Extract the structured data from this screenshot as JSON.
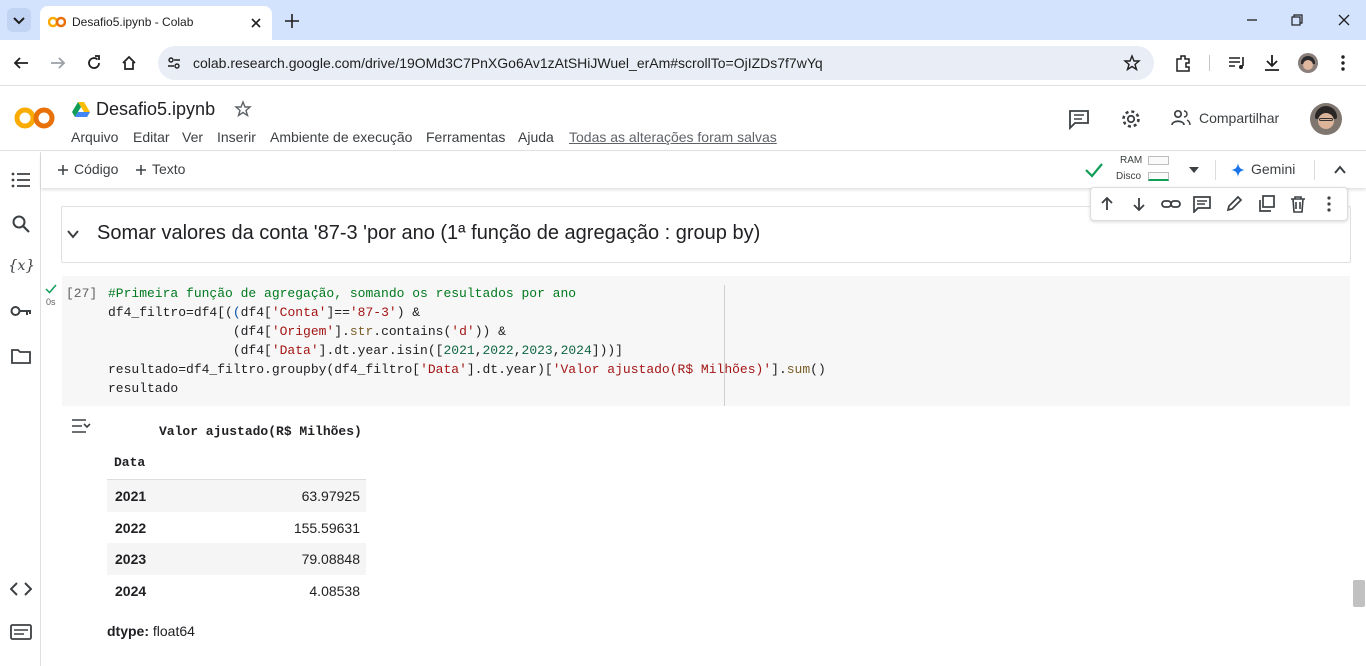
{
  "browser": {
    "tab_title": "Desafio5.ipynb - Colab",
    "url": "colab.research.google.com/drive/19OMd3C7PnXGo6Av1zAtSHiJWuel_erAm#scrollTo=OjIZDs7f7wYq"
  },
  "colab": {
    "notebook_title": "Desafio5.ipynb",
    "menu": [
      "Arquivo",
      "Editar",
      "Ver",
      "Inserir",
      "Ambiente de execução",
      "Ferramentas",
      "Ajuda"
    ],
    "save_status": "Todas as alterações foram salvas",
    "share_label": "Compartilhar",
    "toolbar": {
      "add_code": "Código",
      "add_text": "Texto",
      "ram_label": "RAM",
      "disk_label": "Disco",
      "gemini_label": "Gemini"
    }
  },
  "text_cell": {
    "heading": "Somar valores da conta '87-3 'por ano (1ª função de agregação : group by)"
  },
  "code_cell": {
    "exec_count": "[27]",
    "exec_time": "0s"
  },
  "output": {
    "series_name": "Valor ajustado(R$ Milhões)",
    "index_name": "Data",
    "rows": [
      {
        "year": "2021",
        "value": "63.97925"
      },
      {
        "year": "2022",
        "value": "155.59631"
      },
      {
        "year": "2023",
        "value": "79.08848"
      },
      {
        "year": "2024",
        "value": "4.08538"
      }
    ],
    "dtype_label": "dtype:",
    "dtype_value": "float64"
  },
  "colors": {
    "tabbar": "#d3e3fd",
    "colab_orange": "#f9ab00",
    "check_green": "#0f9d58",
    "gemini_blue": "#1a73e8"
  }
}
